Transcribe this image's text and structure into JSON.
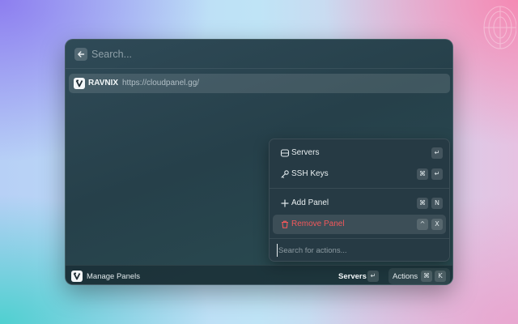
{
  "header": {
    "back_icon": "arrow-left-icon",
    "search_placeholder": "Search..."
  },
  "list": {
    "items": [
      {
        "title": "RAVNIX",
        "subtitle": "https://cloudpanel.gg/",
        "icon": "ravnix-logo-icon"
      }
    ]
  },
  "actions_panel": {
    "groups": [
      {
        "items": [
          {
            "label": "Servers",
            "icon": "server-icon",
            "shortcut": [
              "↵"
            ]
          },
          {
            "label": "SSH Keys",
            "icon": "key-icon",
            "shortcut": [
              "⌘",
              "↵"
            ]
          }
        ]
      },
      {
        "items": [
          {
            "label": "Add Panel",
            "icon": "plus-icon",
            "shortcut": [
              "⌘",
              "N"
            ]
          },
          {
            "label": "Remove Panel",
            "icon": "trash-icon",
            "shortcut": [
              "^",
              "X"
            ],
            "style": "danger",
            "selected": true
          }
        ]
      }
    ],
    "search_placeholder": "Search for actions..."
  },
  "footer": {
    "title": "Manage Panels",
    "primary_action": "Servers",
    "primary_shortcut": "↵",
    "actions_label": "Actions",
    "actions_shortcut": [
      "⌘",
      "K"
    ]
  },
  "colors": {
    "danger": "#f2585b",
    "window_bg": "#26404a",
    "panel_bg": "#263a44"
  }
}
